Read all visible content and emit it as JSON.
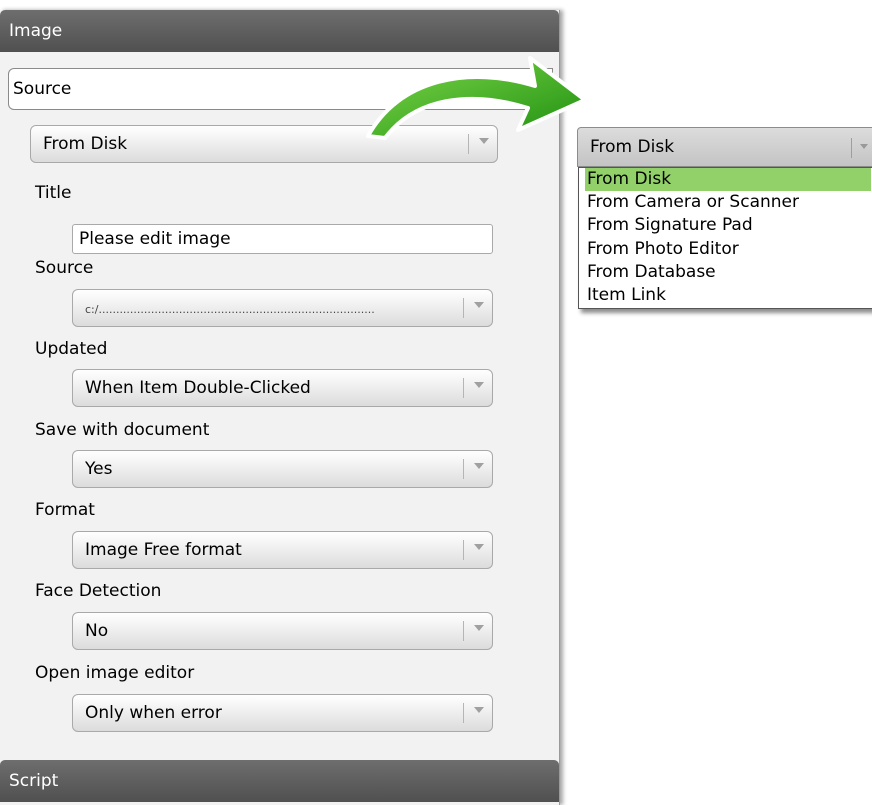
{
  "panel": {
    "header": "Image",
    "source_tab": "Source",
    "source_type": "From Disk",
    "footer_header": "Script"
  },
  "fields": {
    "title": {
      "label": "Title",
      "value": "Please edit image"
    },
    "source": {
      "label": "Source",
      "value": "c:/..............................................................................."
    },
    "updated": {
      "label": "Updated",
      "value": "When Item Double-Clicked"
    },
    "save_with_document": {
      "label": "Save with document",
      "value": "Yes"
    },
    "format": {
      "label": "Format",
      "value": "Image Free format"
    },
    "face_detection": {
      "label": "Face Detection",
      "value": "No"
    },
    "open_image_editor": {
      "label": "Open image editor",
      "value": "Only when error"
    }
  },
  "dropdown": {
    "selected": "From Disk",
    "options": [
      "From Disk",
      "From Camera or Scanner",
      "From Signature Pad",
      "From Photo Editor",
      "From Database",
      "Item Link"
    ],
    "highlight_color": "#92d169"
  },
  "icons": {
    "callout_arrow": "green-curved-arrow-icon",
    "combo_arrow": "chevron-down-icon"
  },
  "colors": {
    "header_bg": "#5a5a5a",
    "arrow_green": "#2fa815"
  }
}
